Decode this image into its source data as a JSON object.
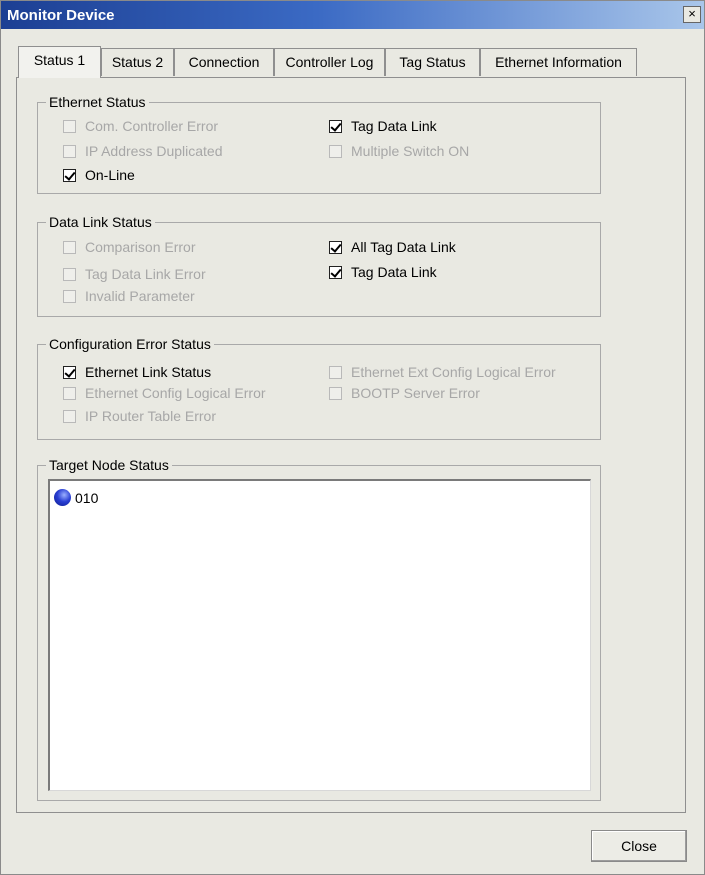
{
  "window": {
    "title": "Monitor Device",
    "close_symbol": "×"
  },
  "tabs": [
    "Status 1",
    "Status 2",
    "Connection",
    "Controller Log",
    "Tag Status",
    "Ethernet Information"
  ],
  "ethernet_status": {
    "title": "Ethernet Status",
    "items": [
      {
        "label": "Com. Controller Error",
        "checked": false,
        "enabled": false
      },
      {
        "label": "IP Address Duplicated",
        "checked": false,
        "enabled": false
      },
      {
        "label": "On-Line",
        "checked": true,
        "enabled": true
      },
      {
        "label": "Tag Data Link",
        "checked": true,
        "enabled": true
      },
      {
        "label": "Multiple Switch ON",
        "checked": false,
        "enabled": false
      }
    ]
  },
  "data_link_status": {
    "title": "Data Link Status",
    "items": [
      {
        "label": "Comparison Error",
        "checked": false,
        "enabled": false
      },
      {
        "label": "Tag Data Link Error",
        "checked": false,
        "enabled": false
      },
      {
        "label": "Invalid Parameter",
        "checked": false,
        "enabled": false
      },
      {
        "label": "All Tag Data Link",
        "checked": true,
        "enabled": true
      },
      {
        "label": "Tag Data Link",
        "checked": true,
        "enabled": true
      }
    ]
  },
  "configuration_error_status": {
    "title": "Configuration Error Status",
    "items": [
      {
        "label": "Ethernet Link Status",
        "checked": true,
        "enabled": true
      },
      {
        "label": "Ethernet Config Logical Error",
        "checked": false,
        "enabled": false
      },
      {
        "label": "IP Router Table Error",
        "checked": false,
        "enabled": false
      },
      {
        "label": "Ethernet Ext Config Logical Error",
        "checked": false,
        "enabled": false
      },
      {
        "label": "BOOTP Server Error",
        "checked": false,
        "enabled": false
      }
    ]
  },
  "target_node_status": {
    "title": "Target Node Status",
    "nodes": [
      {
        "label": "010",
        "icon": "node-status-icon"
      }
    ]
  },
  "buttons": {
    "close": "Close"
  }
}
